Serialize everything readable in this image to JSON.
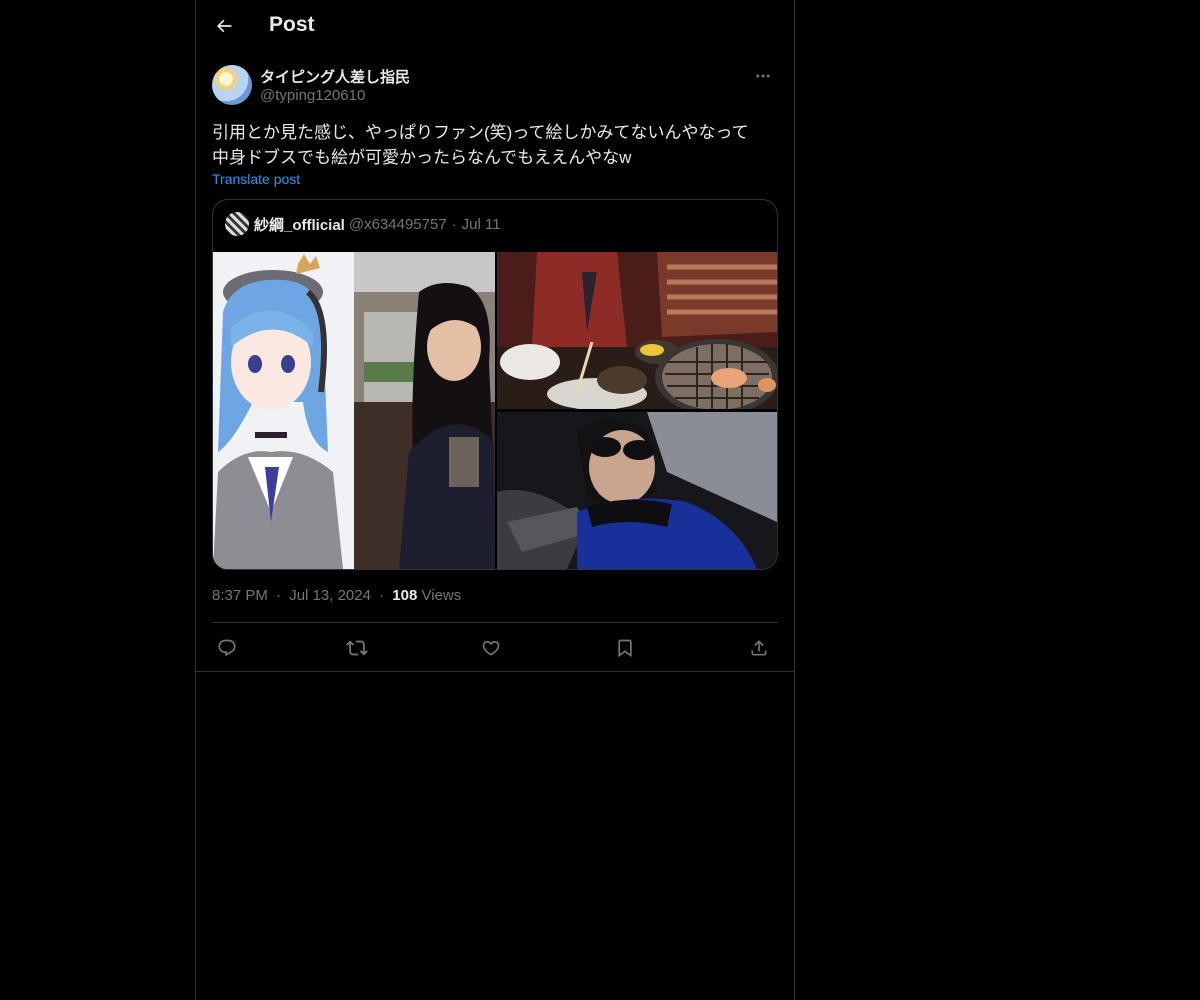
{
  "header": {
    "title": "Post",
    "back_icon": "arrow-left-icon"
  },
  "post": {
    "author": {
      "display_name": "タイピング人差し指民",
      "handle": "@typing120610"
    },
    "text": "引用とか見た感じ、やっぱりファン(笑)って絵しかみてないんやなって\n中身ドブスでも絵が可愛かったらなんでもええんやなw",
    "translate_label": "Translate post",
    "time": "8:37 PM",
    "date": "Jul 13, 2024",
    "separator": "·",
    "views_count": "108",
    "views_label": "Views"
  },
  "quote": {
    "display_name": "紗綱_offlicial",
    "handle": "@x634495757",
    "separator": "·",
    "date": "Jul 11",
    "media_count": 4
  },
  "actions": [
    "reply-icon",
    "repost-icon",
    "like-icon",
    "bookmark-icon",
    "share-icon"
  ],
  "colors": {
    "background": "#000000",
    "text": "#e7e9ea",
    "muted": "#71767b",
    "link": "#1d9bf0",
    "border": "#2f3336"
  }
}
